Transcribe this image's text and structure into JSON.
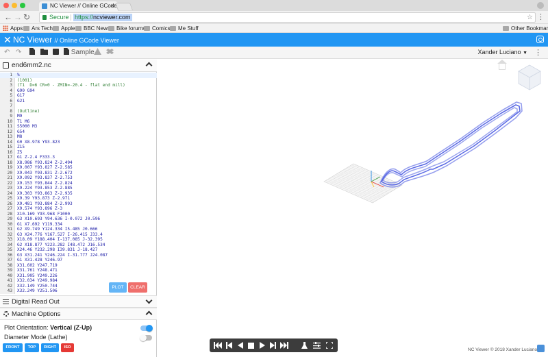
{
  "browser": {
    "tab_title": "NC Viewer // Online GCode Vie",
    "secure_label": "Secure",
    "url_scheme": "https://",
    "url_host": "ncviewer.com",
    "bookmarks": [
      "Apps",
      "Ars Tech",
      "Apple",
      "BBC News",
      "Bike forums",
      "Comics",
      "Me Stuff"
    ],
    "other_bookmarks": "Other Bookmarks"
  },
  "app": {
    "title": "NC Viewer",
    "subtitle": "// Online GCode Viewer",
    "accent_color": "#2196f3"
  },
  "toolbar": {
    "sample_label": "Sample",
    "user_name": "Xander Luciano"
  },
  "editor": {
    "file_name": "end6mm2.nc",
    "lines": [
      {
        "n": "1",
        "t": "%"
      },
      {
        "n": "2",
        "t": "(1001)"
      },
      {
        "n": "3",
        "t": "(T1  D=6 CR=0 - ZMIN=-20.4 - flat end mill)"
      },
      {
        "n": "4",
        "t": "G90 G94"
      },
      {
        "n": "5",
        "t": "G17"
      },
      {
        "n": "6",
        "t": "G21"
      },
      {
        "n": "7",
        "t": ""
      },
      {
        "n": "8",
        "t": "(Outline)"
      },
      {
        "n": "9",
        "t": "M9"
      },
      {
        "n": "10",
        "t": "T1 M6"
      },
      {
        "n": "11",
        "t": "S5000 M3"
      },
      {
        "n": "12",
        "t": "G54"
      },
      {
        "n": "13",
        "t": "M8"
      },
      {
        "n": "14",
        "t": "G0 X8.978 Y93.823"
      },
      {
        "n": "15",
        "t": "Z15"
      },
      {
        "n": "16",
        "t": "Z5"
      },
      {
        "n": "17",
        "t": "G1 Z-2.4 F333.3"
      },
      {
        "n": "18",
        "t": "X8.986 Y93.824 Z-2.494"
      },
      {
        "n": "19",
        "t": "X9.007 Y93.827 Z-2.585"
      },
      {
        "n": "20",
        "t": "X9.043 Y93.831 Z-2.672"
      },
      {
        "n": "21",
        "t": "X9.092 Y93.837 Z-2.753"
      },
      {
        "n": "22",
        "t": "X9.153 Y93.844 Z-2.824"
      },
      {
        "n": "23",
        "t": "X9.224 Y93.853 Z-2.885"
      },
      {
        "n": "24",
        "t": "X9.303 Y93.863 Z-2.935"
      },
      {
        "n": "25",
        "t": "X9.39 Y93.873 Z-2.971"
      },
      {
        "n": "26",
        "t": "X9.481 Y93.884 Z-2.993"
      },
      {
        "n": "27",
        "t": "X9.574 Y93.896 Z-3"
      },
      {
        "n": "28",
        "t": "X10.169 Y93.968 F1000"
      },
      {
        "n": "29",
        "t": "G3 X10.693 Y94.636 I-0.072 J0.596"
      },
      {
        "n": "30",
        "t": "G1 X7.692 Y119.334"
      },
      {
        "n": "31",
        "t": "G2 X9.749 Y124.334 I5.485 J0.666"
      },
      {
        "n": "32",
        "t": "G3 X24.776 Y167.527 I-26.415 J33.4"
      },
      {
        "n": "33",
        "t": "X18.09 Y188.404 I-137.085 J-32.395"
      },
      {
        "n": "34",
        "t": "G2 X18.877 Y223.282 I48.472 J16.534"
      },
      {
        "n": "35",
        "t": "X24.46 Y232.298 I39.831 J-18.427"
      },
      {
        "n": "36",
        "t": "G3 X31.241 Y246.224 I-31.777 J24.087"
      },
      {
        "n": "37",
        "t": "G1 X31.428 Y246.97"
      },
      {
        "n": "38",
        "t": "X31.602 Y247.719"
      },
      {
        "n": "39",
        "t": "X31.761 Y248.471"
      },
      {
        "n": "40",
        "t": "X31.905 Y249.226"
      },
      {
        "n": "41",
        "t": "X32.034 Y249.984"
      },
      {
        "n": "42",
        "t": "X32.149 Y250.744"
      },
      {
        "n": "43",
        "t": "X32.249 Y251.506"
      }
    ],
    "plot_label": "PLOT",
    "clear_label": "CLEAR"
  },
  "sections": {
    "dro_label": "Digital Read Out",
    "machine_label": "Machine Options"
  },
  "options": {
    "orientation_prefix": "Plot Orientation:",
    "orientation_value": "Vertical (Z-Up)",
    "orientation_on": true,
    "diameter_label": "Diameter Mode (Lathe)",
    "diameter_on": false
  },
  "view_buttons": [
    {
      "label": "FRONT",
      "color": "#2196f3"
    },
    {
      "label": "TOP",
      "color": "#2196f3"
    },
    {
      "label": "RIGHT",
      "color": "#2196f3"
    },
    {
      "label": "ISO",
      "color": "#e53935"
    }
  ],
  "viewer": {
    "credit": "NC Viewer © 2018 Xander Luciano",
    "toolpath_color": "#3f51e0"
  }
}
